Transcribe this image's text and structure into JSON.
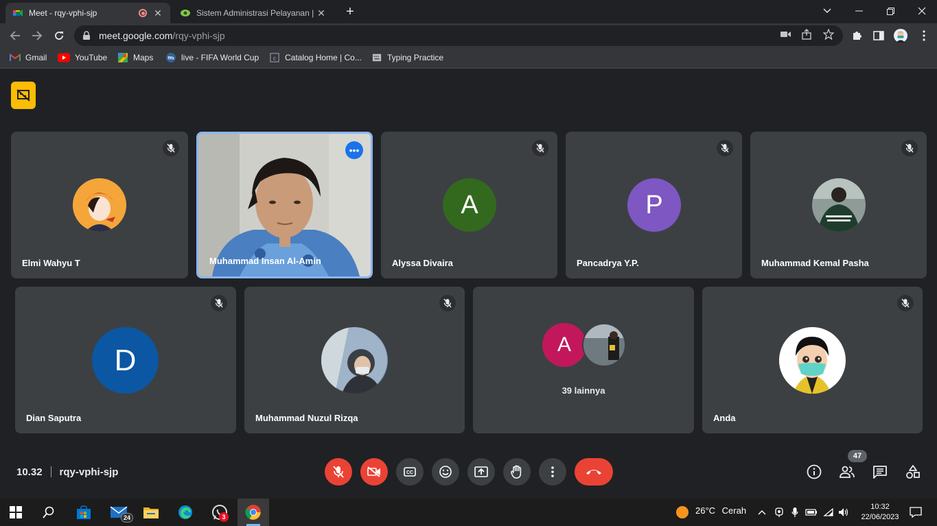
{
  "browser": {
    "tabs": [
      {
        "title": "Meet - rqy-vphi-sjp",
        "active": true
      },
      {
        "title": "Sistem Administrasi Pelayanan | D",
        "active": false
      }
    ],
    "url": {
      "host": "meet.google.com",
      "path": "/rqy-vphi-sjp"
    },
    "bookmarks": [
      {
        "label": "Gmail",
        "icon": "gmail-icon"
      },
      {
        "label": "YouTube",
        "icon": "youtube-icon"
      },
      {
        "label": "Maps",
        "icon": "maps-icon"
      },
      {
        "label": "live - FIFA World Cup",
        "icon": "fifa-icon"
      },
      {
        "label": "Catalog Home | Co...",
        "icon": "catalog-icon"
      },
      {
        "label": "Typing Practice",
        "icon": "typing-icon"
      }
    ]
  },
  "meet": {
    "participants_row1": [
      {
        "name": "Elmi Wahyu T",
        "avatar_type": "photo",
        "muted": true
      },
      {
        "name": "Muhammad Insan Al-Amin",
        "avatar_type": "video",
        "muted": false,
        "speaking": true
      },
      {
        "name": "Alyssa Divaira",
        "avatar_type": "letter",
        "letter": "A",
        "color": "#33691e",
        "muted": true
      },
      {
        "name": "Pancadrya Y.P.",
        "avatar_type": "letter",
        "letter": "P",
        "color": "#7e57c2",
        "muted": true
      },
      {
        "name": "Muhammad Kemal Pasha",
        "avatar_type": "photo",
        "muted": true
      }
    ],
    "participants_row2": [
      {
        "name": "Dian Saputra",
        "avatar_type": "letter",
        "letter": "D",
        "color": "#0b57a4",
        "muted": true
      },
      {
        "name": "Muhammad Nuzul Rizqa",
        "avatar_type": "photo",
        "muted": true
      },
      {
        "name": "",
        "others_label": "39 lainnya",
        "letter": "A",
        "color": "#c2185b"
      },
      {
        "name": "Anda",
        "avatar_type": "photo",
        "muted": true
      }
    ],
    "time": "10.32",
    "meeting_code": "rqy-vphi-sjp",
    "participant_count": "47"
  },
  "taskbar": {
    "mail_badge": "24",
    "whatsapp_badge": "3",
    "weather": {
      "temp": "26°C",
      "condition": "Cerah"
    },
    "time": "10:32",
    "date": "22/06/2023"
  }
}
